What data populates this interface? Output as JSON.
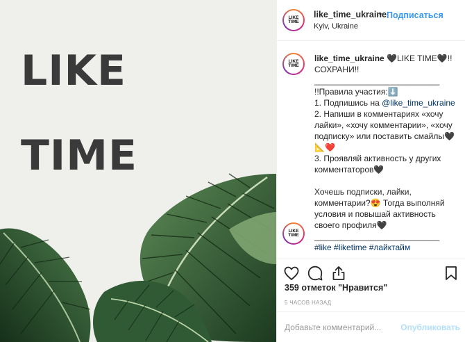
{
  "image": {
    "brand_line1": "LIKE",
    "brand_line2": "TIME"
  },
  "header": {
    "avatar_text": "LIKE\nTIME",
    "username": "like_time_ukraine",
    "separator": "•",
    "follow_label": "Подписаться",
    "location": "Kyiv, Ukraine"
  },
  "caption": {
    "username": "like_time_ukraine",
    "line_title": " 🖤LIKE TIME🖤!! СОХРАНИ!!",
    "divider": "___________________________",
    "rules_title": "!!Правила участия:⬇️",
    "rule1_prefix": "1. Подпишись на ",
    "rule1_mention": "@like_time_ukraine",
    "rule2": "2. Напиши в комментариях «хочу лайки», «хочу комментарии», «хочу подписку» или поставить смайлы🖤📐❤️",
    "rule3": "3. Проявляй активность у других комментаторов🖤",
    "closing": "Хочешь подписки, лайки, комментарии?😍 Тогда выполняй условия и повышай активность своего профиля🖤",
    "divider2": "___________________________",
    "hashtags": "#like #liketime #лайктайм"
  },
  "icons": {
    "like": "heart-outline-icon",
    "comment": "speech-bubble-icon",
    "share": "share-arrow-icon",
    "save": "bookmark-icon"
  },
  "likes": "359 отметок \"Нравится\"",
  "timestamp": "5 ЧАСОВ НАЗАД",
  "comment_box": {
    "placeholder": "Добавьте комментарий...",
    "post_label": "Опубликовать"
  },
  "colors": {
    "link": "#3897f0",
    "post_disabled": "#b2dffc",
    "leaf_dark": "#1f3d23",
    "leaf_mid": "#3e6b3f"
  }
}
